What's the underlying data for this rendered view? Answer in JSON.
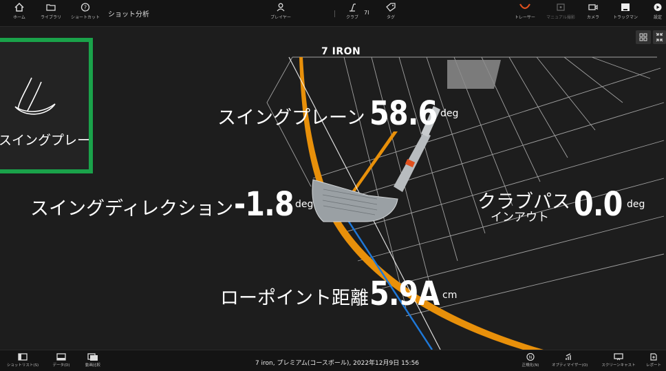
{
  "toolbar": {
    "home": "ホーム",
    "library": "ライブラリ",
    "shortcut": "ショートカット",
    "title": "ショット分析",
    "player": "プレイヤー",
    "club": "クラブ",
    "club_value": "7I",
    "tag": "タグ",
    "tracer": "トレーサー",
    "manual_measure": "マニュアル撮影",
    "camera": "カメラ",
    "trackman": "トラックマン",
    "settings": "設定"
  },
  "view": {
    "club_name": "7 IRON",
    "panel_label": "スイングプレーン",
    "metrics": {
      "swing_plane": {
        "label": "スイングプレーン",
        "value": "58.6",
        "unit": "deg"
      },
      "swing_direction": {
        "label": "スイングディレクション",
        "value": "-1.8",
        "unit": "deg"
      },
      "club_path": {
        "label": "クラブパス",
        "sublabel": "インアウト",
        "value": "0.0",
        "unit": "deg"
      },
      "low_point": {
        "label": "ローポイント距離",
        "value": "5.9A",
        "unit": "cm"
      }
    }
  },
  "bottombar": {
    "shot_list": "ショットリスト(S)",
    "data": "データ(D)",
    "compare": "動画比較",
    "shot_info": "7 iron, プレミアム(コースボール), 2022年12月9日 15:56",
    "normalize": "正規化(N)",
    "optimizer": "オプティマイザー(O)",
    "screencast": "スクリーンキャスト",
    "report": "レポート"
  },
  "colors": {
    "accent_green": "#1aa24a",
    "swing_orange": "#e8900a",
    "path_blue": "#1e78d8",
    "tracer_red": "#e0501e"
  }
}
